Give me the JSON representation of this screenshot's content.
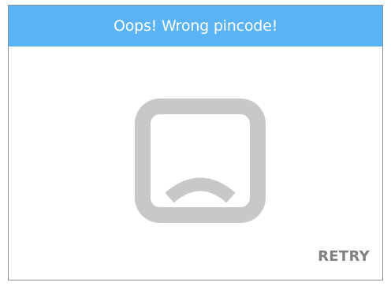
{
  "dialog": {
    "title": "Oops! Wrong pincode!",
    "icon": "sad-face-icon",
    "retry_label": "RETRY"
  },
  "colors": {
    "header": "#5ab3f5",
    "title_text": "#ffffff",
    "icon": "#c8c8c8",
    "retry_text": "#808080",
    "border": "#8e8e8e"
  }
}
